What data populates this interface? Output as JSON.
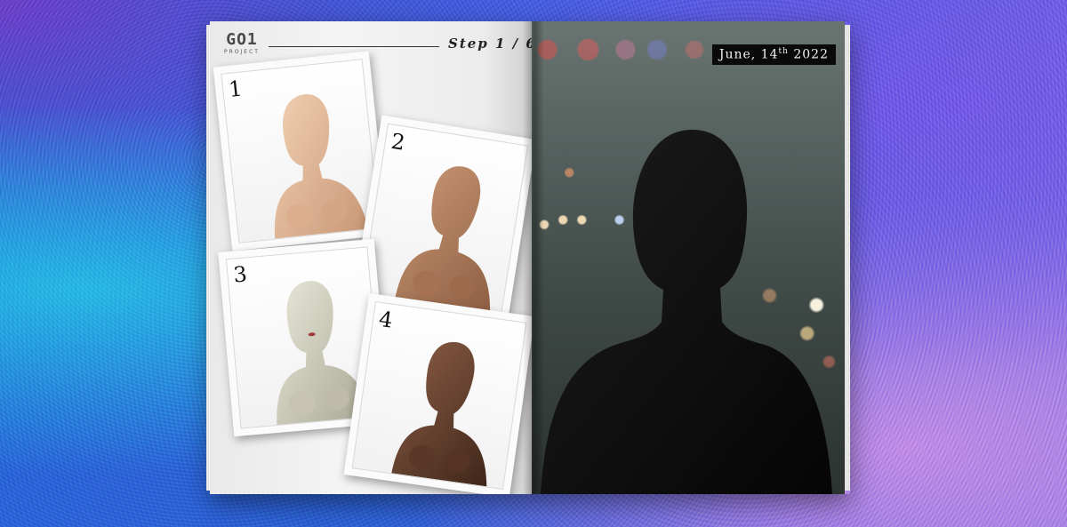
{
  "magazine": {
    "left_page": {
      "brand": {
        "logo": "GO1",
        "sub": "PROJECT"
      },
      "step_label": "Step 1 / 6",
      "cards": [
        {
          "number": "1"
        },
        {
          "number": "2"
        },
        {
          "number": "3"
        },
        {
          "number": "4"
        }
      ]
    },
    "right_page": {
      "date": {
        "month_day": "June, 14",
        "suffix": "th",
        "year": " 2022"
      }
    }
  },
  "colors": {
    "skin_1": "#e9c3a2",
    "skin_2": "#b98461",
    "skin_3": "#d9d6c6",
    "skin_4": "#6a4634",
    "silhouette": "#0b0b0b"
  }
}
